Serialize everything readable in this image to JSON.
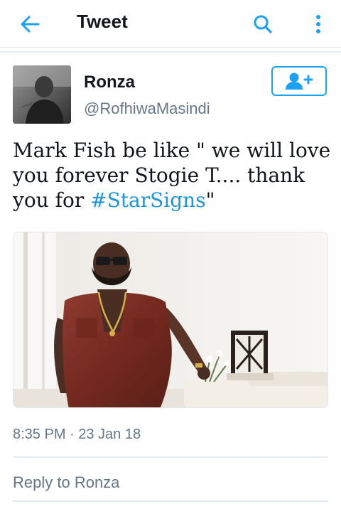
{
  "header": {
    "title": "Tweet",
    "back_icon": "arrow-left-icon",
    "search_icon": "search-icon",
    "more_icon": "more-vertical-icon"
  },
  "tweet": {
    "author": {
      "name": "Ronza",
      "handle": "@RofhiwaMasindi"
    },
    "text_prefix": "Mark Fish be like \" we will love you forever Stogie T.... thank you for ",
    "hashtag": "#StarSigns",
    "text_suffix": "\"",
    "timestamp": "8:35 PM · 23 Jan 18"
  },
  "follow_button": {
    "icon": "add-user-icon"
  },
  "reply": {
    "placeholder": "Reply to Ronza"
  },
  "colors": {
    "accent": "#1da1f2",
    "hashtag": "#1b95e0",
    "muted": "#657786",
    "text": "#14171a"
  }
}
